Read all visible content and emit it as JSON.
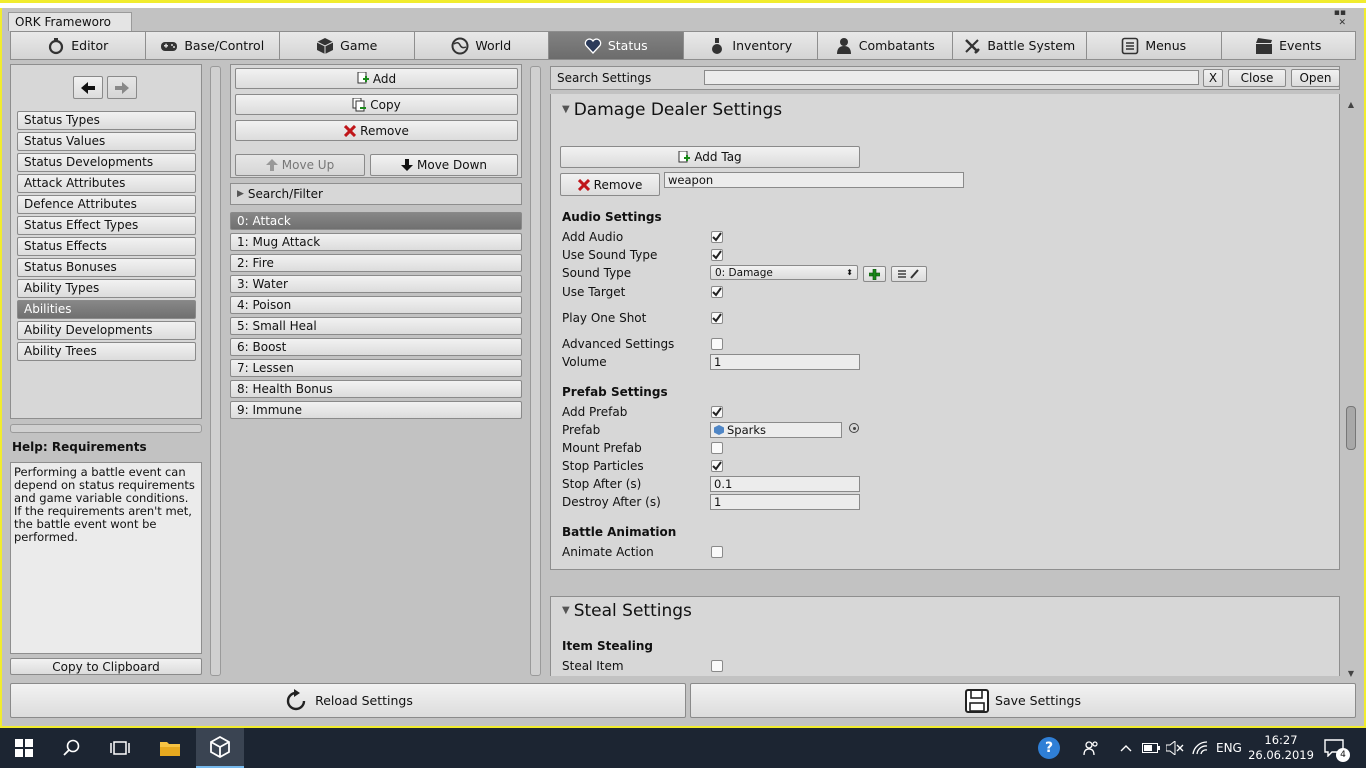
{
  "window": {
    "tab_title": "ORK Frameworo"
  },
  "tabs": [
    {
      "label": "Editor",
      "icon": "editor-icon"
    },
    {
      "label": "Base/Control",
      "icon": "gamepad-icon"
    },
    {
      "label": "Game",
      "icon": "cube-icon"
    },
    {
      "label": "World",
      "icon": "globe-icon"
    },
    {
      "label": "Status",
      "icon": "heart-icon"
    },
    {
      "label": "Inventory",
      "icon": "potion-icon"
    },
    {
      "label": "Combatants",
      "icon": "person-icon"
    },
    {
      "label": "Battle System",
      "icon": "sword-icon"
    },
    {
      "label": "Menus",
      "icon": "menu-icon"
    },
    {
      "label": "Events",
      "icon": "clapper-icon"
    }
  ],
  "active_tab": "Status",
  "sidebar": {
    "items": [
      "Status Types",
      "Status Values",
      "Status Developments",
      "Attack Attributes",
      "Defence Attributes",
      "Status Effect Types",
      "Status Effects",
      "Status Bonuses",
      "Ability Types",
      "Abilities",
      "Ability Developments",
      "Ability Trees"
    ],
    "active": "Abilities",
    "help_title": "Help: Requirements",
    "help_text": "Performing a battle event can depend on status requirements and game variable conditions. If the requirements aren't met, the battle event wont be performed.",
    "copy_label": "Copy to Clipboard"
  },
  "list_panel": {
    "add_label": "Add",
    "copy_label": "Copy",
    "remove_label": "Remove",
    "move_up_label": "Move Up",
    "move_down_label": "Move Down",
    "search_filter_label": "Search/Filter",
    "items": [
      "0: Attack",
      "1: Mug Attack",
      "2: Fire",
      "3: Water",
      "4: Poison",
      "5: Small Heal",
      "6: Boost",
      "7: Lessen",
      "8: Health Bonus",
      "9: Immune"
    ],
    "active": "0: Attack"
  },
  "search": {
    "label": "Search Settings",
    "value": "",
    "clear_label": "X",
    "close_label": "Close",
    "open_label": "Open"
  },
  "damage_dealer": {
    "title": "Damage Dealer Settings",
    "add_tag_label": "Add Tag",
    "remove_label": "Remove",
    "tag_value": "weapon",
    "audio_title": "Audio Settings",
    "add_audio": "Add Audio",
    "use_sound_type": "Use Sound Type",
    "sound_type": "Sound Type",
    "sound_type_value": "0: Damage",
    "use_target": "Use Target",
    "play_one_shot": "Play One Shot",
    "advanced_settings": "Advanced Settings",
    "volume": "Volume",
    "volume_value": "1",
    "prefab_title": "Prefab Settings",
    "add_prefab": "Add Prefab",
    "prefab": "Prefab",
    "prefab_value": "Sparks",
    "mount_prefab": "Mount Prefab",
    "stop_particles": "Stop Particles",
    "stop_after": "Stop After (s)",
    "stop_after_value": "0.1",
    "destroy_after": "Destroy After (s)",
    "destroy_after_value": "1",
    "battle_anim_title": "Battle Animation",
    "animate_action": "Animate Action"
  },
  "steal": {
    "title": "Steal Settings",
    "item_stealing": "Item Stealing",
    "steal_item": "Steal Item"
  },
  "bottom": {
    "reload_label": "Reload Settings",
    "save_label": "Save Settings"
  },
  "taskbar": {
    "lang": "ENG",
    "time": "16:27",
    "date": "26.06.2019",
    "notifications": "4"
  },
  "colors": {
    "accent_yellow": "#f1ec2e",
    "active_tab": "#787878",
    "taskbar": "#1c2532"
  }
}
